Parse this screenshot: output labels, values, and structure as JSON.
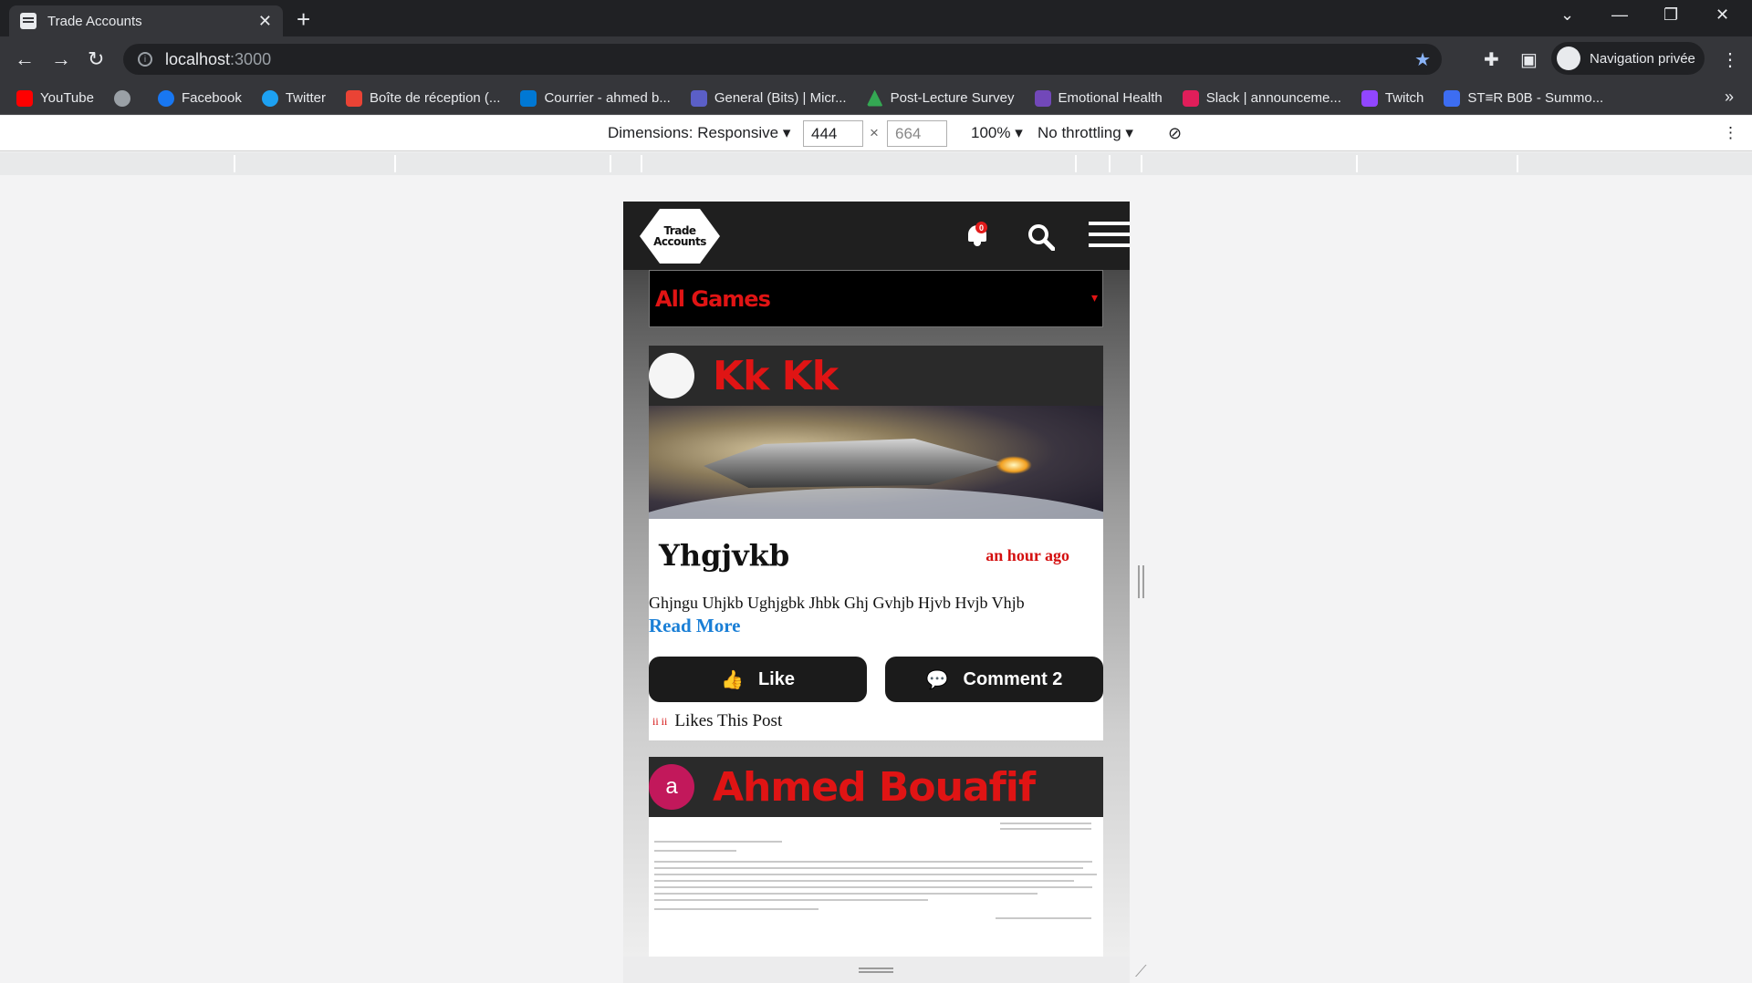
{
  "browser": {
    "tab_title": "Trade Accounts",
    "url_host": "localhost",
    "url_port": ":3000",
    "profile_label": "Navigation privée",
    "bookmarks": [
      {
        "label": "YouTube",
        "color": "#ff0000"
      },
      {
        "label": "",
        "color": "#9aa0a6"
      },
      {
        "label": "Facebook",
        "color": "#1877f2"
      },
      {
        "label": "Twitter",
        "color": "#1da1f2"
      },
      {
        "label": "Boîte de réception (...",
        "color": "#ea4335"
      },
      {
        "label": "Courrier - ahmed b...",
        "color": "#0078d4"
      },
      {
        "label": "General (Bits) | Micr...",
        "color": "#5b5fc7"
      },
      {
        "label": "Post-Lecture Survey",
        "color": "#34a853"
      },
      {
        "label": "Emotional Health",
        "color": "#7248b9"
      },
      {
        "label": "Slack | announceme...",
        "color": "#e01e5a"
      },
      {
        "label": "Twitch",
        "color": "#9146ff"
      },
      {
        "label": "ST≡R B0B - Summo...",
        "color": "#3d6df2"
      }
    ]
  },
  "devtools": {
    "dimensions_label": "Dimensions: Responsive",
    "width": "444",
    "times": "×",
    "height": "664",
    "zoom": "100%",
    "throttling": "No throttling"
  },
  "app": {
    "logo_line1": "Trade",
    "logo_line2": "Accounts",
    "notification_count": "0",
    "filter_selected": "All Games",
    "posts": [
      {
        "author": "Kk Kk",
        "title": "Yhgjvkb",
        "time": "an hour ago",
        "body": "Ghjngu Uhjkb Ughjgbk Jhbk Ghj Gvhjb Hjvb Hvjb Vhjb",
        "read_more": "Read More",
        "like_label": "Like",
        "comment_label": "Comment 2",
        "likes_by": "ii ii",
        "likes_text": "Likes This Post"
      },
      {
        "author": "Ahmed Bouafif",
        "avatar_letter": "a",
        "avatar_color": "#c2185b"
      }
    ]
  }
}
